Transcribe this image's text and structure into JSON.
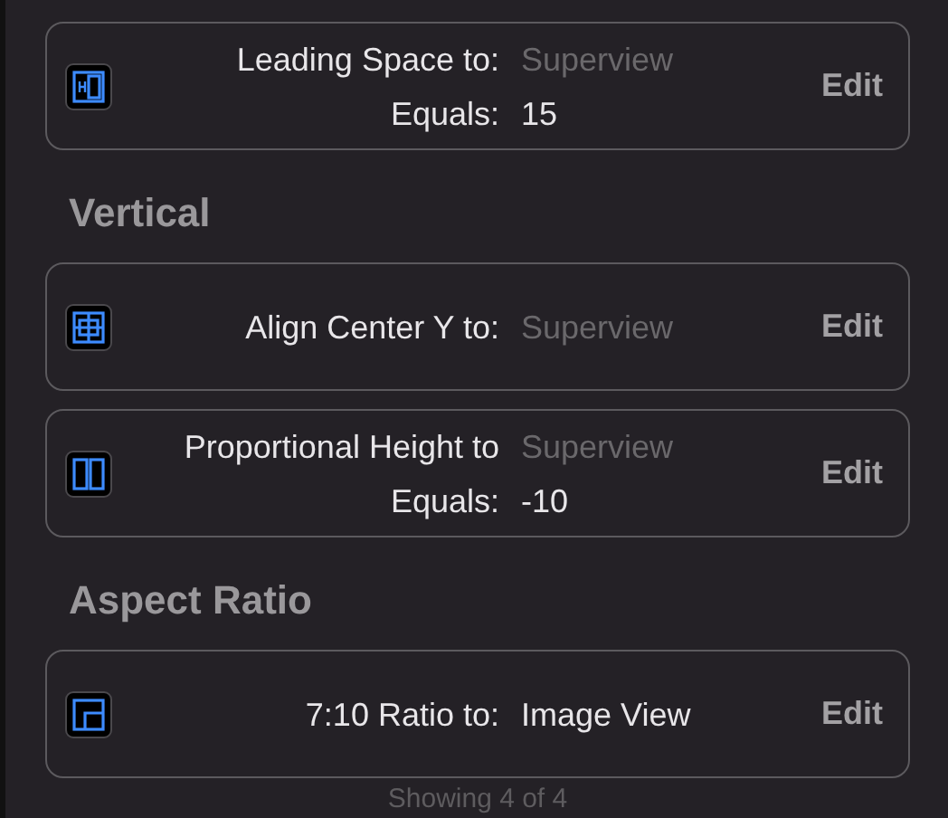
{
  "sections": [
    {
      "items": [
        {
          "kind": "leading",
          "label": "Leading Space to:",
          "target": "Superview",
          "target_dimmed": true,
          "constant_label": "Equals:",
          "constant": "15",
          "action": "Edit"
        }
      ]
    },
    {
      "title": "Vertical",
      "items": [
        {
          "kind": "center-y",
          "label": "Align Center Y to:",
          "target": "Superview",
          "target_dimmed": true,
          "action": "Edit"
        },
        {
          "kind": "proportional-height",
          "label": "Proportional Height to",
          "target": "Superview",
          "target_dimmed": true,
          "constant_label": "Equals:",
          "constant": "-10",
          "action": "Edit"
        }
      ]
    },
    {
      "title": "Aspect Ratio",
      "items": [
        {
          "kind": "aspect",
          "label": "7:10 Ratio to:",
          "target": "Image View",
          "target_dimmed": false,
          "action": "Edit"
        }
      ]
    }
  ],
  "footer": "Showing 4 of 4"
}
